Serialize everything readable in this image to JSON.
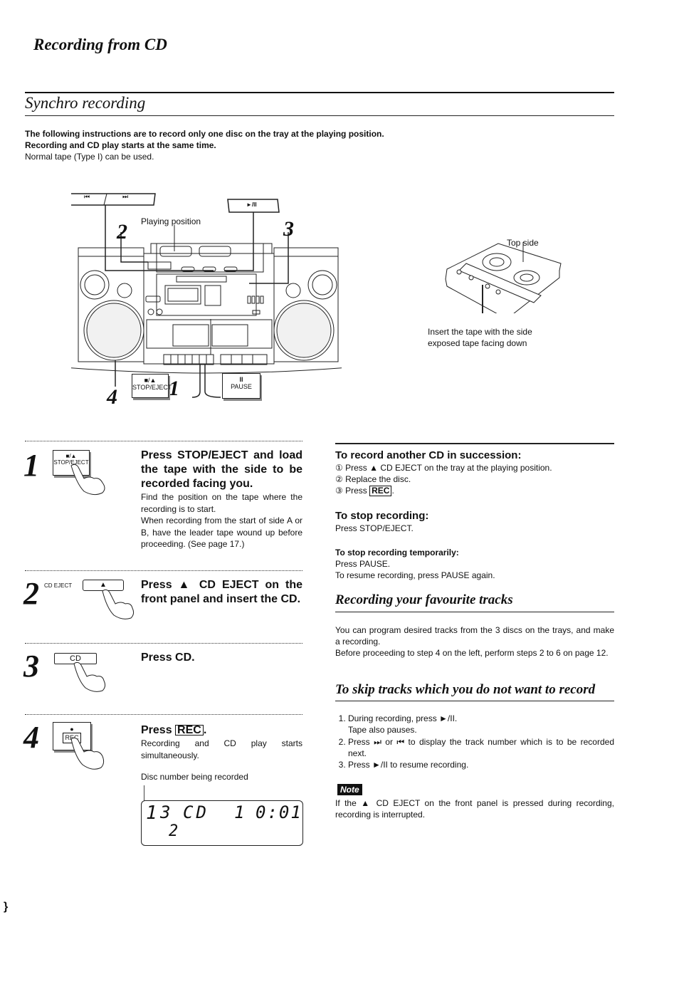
{
  "page": {
    "title": "Recording from CD",
    "margin_mark": "}"
  },
  "synchro": {
    "title": "Synchro recording",
    "intro": [
      "The following instructions are to record only one disc on the tray at the playing position.",
      "Recording and CD play starts at the same time.",
      "Normal tape (Type I) can be used."
    ]
  },
  "diagram": {
    "buttons": {
      "prev": "⏮",
      "next": "⏭",
      "play_pause": "►/II",
      "stop_eject_symbol": "■/▲",
      "stop_eject": "STOP/EJECT",
      "pause_symbol": "II",
      "pause": "PAUSE"
    },
    "callouts": [
      "1",
      "2",
      "3",
      "4"
    ],
    "playing_position_label": "Playing position",
    "cassette_top_label": "Top side",
    "cassette_insert_label_1": "Insert the tape with the side",
    "cassette_insert_label_2": "exposed tape facing down"
  },
  "steps": [
    {
      "num": "1",
      "button_symbol": "■/▲",
      "button_label": "STOP/EJECT",
      "heading": "Press STOP/EJECT and load the tape with the side to be recorded facing you.",
      "body": [
        "Find the position on the tape where the recording is to start.",
        "When recording from the start of side A or B, have the leader tape wound up before proceeding. (See page 17.)"
      ]
    },
    {
      "num": "2",
      "button_prefix": "CD EJECT",
      "button_symbol": "▲",
      "heading": "Press ▲ CD EJECT on the front panel and insert the CD."
    },
    {
      "num": "3",
      "button_label": "CD",
      "heading": "Press CD."
    },
    {
      "num": "4",
      "button_label": "REC",
      "heading_prefix": "Press",
      "heading_key": "REC",
      "heading_suffix": ".",
      "body": "Recording and CD play starts simultaneously.",
      "display_caption": "Disc number being recorded",
      "display": {
        "disc_active": "1",
        "disc_3": "3",
        "disc_2": "2",
        "mode": "CD",
        "track": "1",
        "time": "0:01"
      }
    }
  ],
  "right": {
    "another_cd": {
      "heading": "To record another CD in succession:",
      "items": [
        {
          "marker": "①",
          "text": "Press ▲ CD EJECT on the tray at the playing position."
        },
        {
          "marker": "②",
          "text": "Replace the disc."
        },
        {
          "marker": "③",
          "text_prefix": "Press",
          "key": "REC",
          "text_suffix": "."
        }
      ]
    },
    "stop_recording": {
      "heading": "To stop recording:",
      "body": "Press STOP/EJECT."
    },
    "stop_temp": {
      "heading": "To stop recording temporarily:",
      "body": [
        "Press PAUSE.",
        "To resume recording, press PAUSE again."
      ]
    },
    "favourite": {
      "title": "Recording your favourite tracks",
      "body": [
        "You can program desired tracks from the 3 discs on the trays, and make a recording.",
        "Before proceeding to step 4 on the left, perform steps 2 to 6 on page 12."
      ]
    },
    "skip": {
      "title": "To skip tracks which you do not want to record",
      "items": [
        {
          "text": "During recording, press ►/II.",
          "sub": "Tape also pauses."
        },
        {
          "text": "Press ⏭ or ⏮ to display the track number which is to be recorded next."
        },
        {
          "text": "Press ►/II to resume recording."
        }
      ]
    },
    "note": {
      "badge": "Note",
      "body": "If the ▲ CD EJECT on the front panel is pressed during recording, recording is interrupted."
    }
  }
}
